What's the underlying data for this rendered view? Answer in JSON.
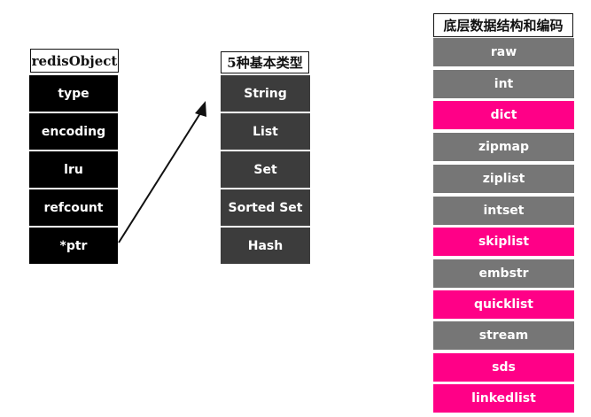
{
  "redis_object": {
    "title": "redisObject",
    "fields": [
      "type",
      "encoding",
      "lru",
      "refcount",
      "*ptr"
    ]
  },
  "basic_types": {
    "title": "5种基本类型",
    "items": [
      "String",
      "List",
      "Set",
      "Sorted Set",
      "Hash"
    ]
  },
  "encodings": {
    "title": "底层数据结构和编码",
    "items": [
      {
        "label": "raw",
        "color": "gray"
      },
      {
        "label": "int",
        "color": "gray"
      },
      {
        "label": "dict",
        "color": "pink"
      },
      {
        "label": "zipmap",
        "color": "gray"
      },
      {
        "label": "ziplist",
        "color": "gray"
      },
      {
        "label": "intset",
        "color": "gray"
      },
      {
        "label": "skiplist",
        "color": "pink"
      },
      {
        "label": "embstr",
        "color": "gray"
      },
      {
        "label": "quicklist",
        "color": "pink"
      },
      {
        "label": "stream",
        "color": "gray"
      },
      {
        "label": "sds",
        "color": "pink"
      },
      {
        "label": "linkedlist",
        "color": "pink"
      }
    ]
  },
  "colors": {
    "black": "#000000",
    "dark": "#3c3c3c",
    "gray": "#767676",
    "pink": "#ff0087"
  }
}
